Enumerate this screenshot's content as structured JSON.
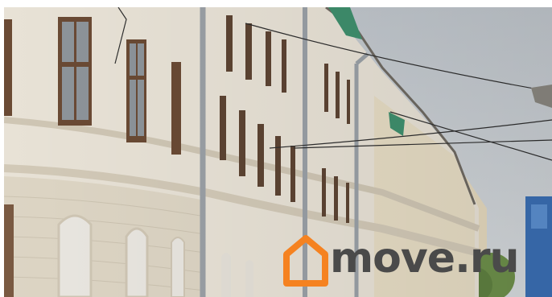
{
  "photo": {
    "subject": "historic-building-facade",
    "colors": {
      "sky": "#c9ced3",
      "facade_main": "#e8e2d6",
      "facade_shadow": "#d7cfc0",
      "facade_right": "#e6dcc4",
      "window_frame": "#6a4a34",
      "window_glass": "#8d949a",
      "drainpipe": "#9aa0a6",
      "trim_green": "#3f8f6d"
    }
  },
  "watermark": {
    "icon": "house-outline-icon",
    "icon_color": "#f58220",
    "text": "move.ru",
    "text_color": "#4a4a4a"
  }
}
